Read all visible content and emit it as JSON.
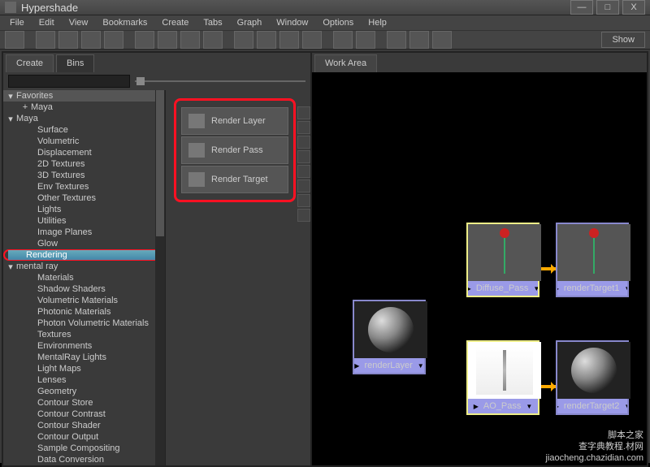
{
  "window": {
    "title": "Hypershade",
    "min": "—",
    "max": "□",
    "close": "X"
  },
  "menu": [
    "File",
    "Edit",
    "View",
    "Bookmarks",
    "Create",
    "Tabs",
    "Graph",
    "Window",
    "Options",
    "Help"
  ],
  "toolbar": {
    "show": "Show"
  },
  "tabs": {
    "create": "Create",
    "bins": "Bins",
    "workarea": "Work Area"
  },
  "tree": {
    "favorites": "Favorites",
    "maya_plus": "Maya",
    "maya": "Maya",
    "maya_items": [
      "Surface",
      "Volumetric",
      "Displacement",
      "2D Textures",
      "3D Textures",
      "Env Textures",
      "Other Textures",
      "Lights",
      "Utilities",
      "Image Planes",
      "Glow"
    ],
    "rendering": "Rendering",
    "mentalray": "mental ray",
    "mentalray_items": [
      "Materials",
      "Shadow Shaders",
      "Volumetric Materials",
      "Photonic Materials",
      "Photon Volumetric Materials",
      "Textures",
      "Environments",
      "MentalRay Lights",
      "Light Maps",
      "Lenses",
      "Geometry",
      "Contour Store",
      "Contour Contrast",
      "Contour Shader",
      "Contour Output",
      "Sample Compositing",
      "Data Conversion"
    ]
  },
  "render_buttons": {
    "layer": "Render Layer",
    "pass": "Render Pass",
    "target": "Render Target"
  },
  "nodes": {
    "renderLayer": "renderLayer",
    "diffuse": "Diffuse_Pass",
    "ao": "AO_Pass",
    "rt1": "renderTarget1",
    "rt2": "renderTarget2"
  },
  "watermark": {
    "line1": "脚本之家",
    "line2": "查字典教程.材网",
    "line3": "jiaocheng.chazidian.com"
  }
}
